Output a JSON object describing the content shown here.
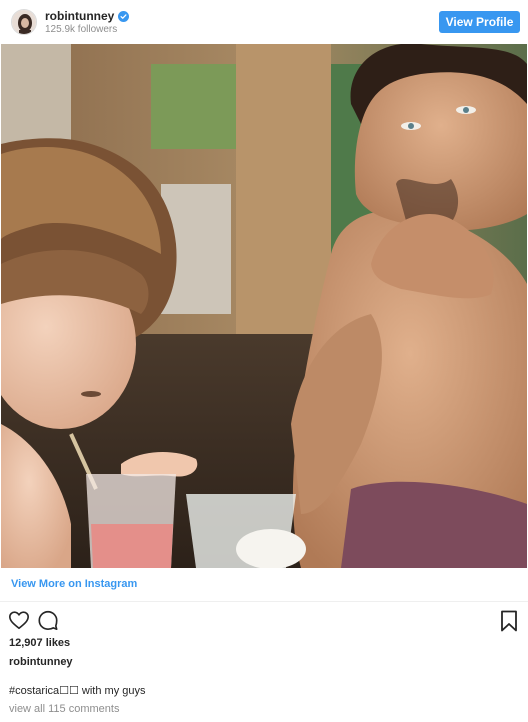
{
  "header": {
    "username": "robintunney",
    "followers": "125.9k followers",
    "view_profile_label": "View Profile"
  },
  "post": {
    "photo_icon": "photo-image",
    "view_more_label": "View More on Instagram",
    "likes": "12,907 likes",
    "caption_user": "robintunney",
    "caption_text": "#costarica☐☐ with my guys",
    "comments_link": "view all 115 comments"
  },
  "icons": {
    "like": "heart-icon",
    "comment": "comment-icon",
    "save": "bookmark-icon",
    "verified": "verified-badge-icon"
  },
  "colors": {
    "accent": "#3897f0",
    "muted": "#8e8e8e",
    "text": "#262626"
  }
}
